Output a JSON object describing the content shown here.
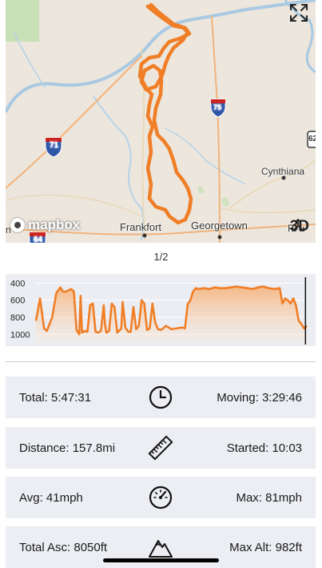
{
  "map": {
    "labels": {
      "cynthiana": "Cynthiana",
      "frankfort": "Frankfort",
      "georgetown": "Georgetown",
      "interstate_71": "71",
      "interstate_75": "75",
      "interstate_64": "64",
      "us_route": "62",
      "edge_left": "n",
      "edge_right": "P"
    },
    "attribution": "mapbox",
    "view_toggle": "3D",
    "route_color": "#f07e26",
    "fullscreen_icon": "expand-arrows-icon"
  },
  "pager": "1/2",
  "elevation": {
    "y_ticks": [
      "1000",
      "800",
      "600",
      "400"
    ],
    "color": "#f07e26",
    "chart_data": {
      "type": "area",
      "ylim": [
        300,
        1050
      ],
      "y_ticks": [
        400,
        600,
        800,
        1000
      ],
      "x": [
        0,
        1.5,
        3,
        4,
        5,
        6,
        7.5,
        9,
        10,
        11,
        13,
        14,
        15,
        16,
        16.5,
        17,
        18,
        19,
        20,
        21,
        22,
        23,
        24,
        25,
        25.5,
        26,
        27,
        28,
        29,
        30,
        31,
        31.5,
        32,
        33,
        34,
        35,
        36,
        37,
        38,
        39,
        40,
        41,
        42,
        43,
        44,
        45,
        46,
        47,
        48,
        49,
        50,
        52,
        54,
        55,
        56,
        57,
        58,
        59,
        60,
        62,
        64,
        66,
        68,
        70,
        72,
        74,
        76,
        78,
        80,
        82,
        84,
        86,
        88,
        90,
        91,
        92,
        93,
        94,
        95,
        96,
        97,
        98,
        99,
        100
      ],
      "y": [
        560,
        820,
        470,
        440,
        520,
        600,
        880,
        950,
        900,
        900,
        930,
        900,
        450,
        400,
        850,
        420,
        440,
        430,
        740,
        760,
        430,
        420,
        440,
        740,
        520,
        420,
        440,
        760,
        720,
        420,
        450,
        470,
        780,
        480,
        430,
        430,
        720,
        460,
        500,
        800,
        760,
        450,
        470,
        760,
        540,
        460,
        450,
        470,
        500,
        480,
        460,
        470,
        480,
        470,
        750,
        800,
        900,
        940,
        930,
        940,
        930,
        950,
        940,
        940,
        950,
        960,
        950,
        940,
        930,
        950,
        960,
        940,
        930,
        940,
        760,
        820,
        800,
        760,
        820,
        740,
        560,
        520,
        470,
        500,
        430
      ],
      "marker_x": 99.5
    }
  },
  "stats": {
    "total": "Total: 5:47:31",
    "moving": "Moving: 3:29:46",
    "distance": "Distance: 157.8mi",
    "started": "Started: 10:03",
    "avg": "Avg: 41mph",
    "max": "Max: 81mph",
    "total_asc": "Total Asc: 8050ft",
    "max_alt": "Max Alt: 982ft"
  }
}
